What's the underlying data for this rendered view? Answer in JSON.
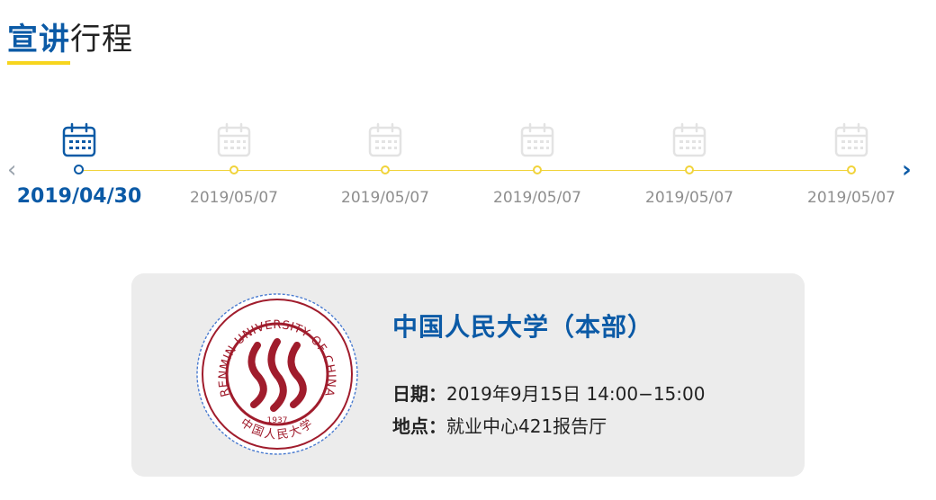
{
  "header": {
    "title_bold": "宣讲",
    "title_rest": "行程"
  },
  "nav": {
    "prev_icon": "chevron-left-icon",
    "next_icon": "chevron-right-icon",
    "prev": "‹",
    "next": "›"
  },
  "timeline": {
    "items": [
      {
        "date": "2019/04/30",
        "active": true
      },
      {
        "date": "2019/05/07",
        "active": false
      },
      {
        "date": "2019/05/07",
        "active": false
      },
      {
        "date": "2019/05/07",
        "active": false
      },
      {
        "date": "2019/05/07",
        "active": false
      },
      {
        "date": "2019/05/07",
        "active": false
      }
    ]
  },
  "card": {
    "university": "中国人民大学（本部）",
    "date_label": "日期：",
    "date_value": "2019年9月15日  14:00−15:00",
    "place_label": "地点：",
    "place_value": "就业中心421报告厅",
    "logo": {
      "ring_text": "RENMIN UNIVERSITY OF CHINA",
      "year": "1937",
      "seal_text": "中国人民大学"
    }
  },
  "colors": {
    "accent": "#0b5aa6",
    "highlight": "#f7d51d",
    "seal": "#a01c2c",
    "card_bg": "#ececec"
  }
}
